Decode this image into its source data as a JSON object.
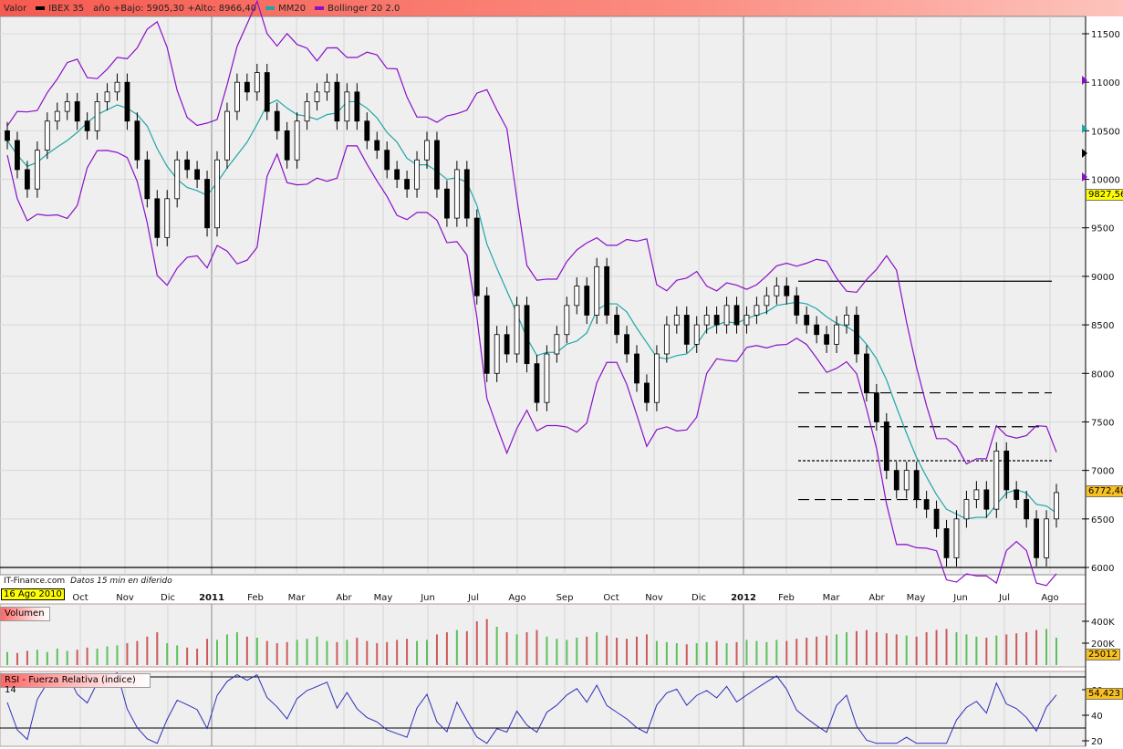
{
  "header": {
    "valor": "Valor",
    "series": "IBEX 35",
    "range": "año +Bajo: 5905,30 +Alto: 8966,40",
    "mm": "MM20",
    "boll": "Bollinger 20 2.0"
  },
  "colors": {
    "mm": "#1fa6a6",
    "boll": "#8a10c8",
    "rsi": "#2e2eb8",
    "vol_up": "#5cc05c",
    "vol_down": "#cc5a5a",
    "header": "#f65a50"
  },
  "credit": {
    "site": "IT-Finance.com",
    "note": "Datos 15 min en diferido"
  },
  "start_date": "16 Ago 2010",
  "volume_title": "Volumen",
  "rsi_title": "RSI - Fuerza Relativa (indice) 14",
  "tags": {
    "price_high": "9827,56",
    "last": "6772,40",
    "volume": "25012",
    "rsi": "54,423"
  },
  "chart_data": {
    "type": "candlestick",
    "title": "IBEX 35",
    "price_axis": {
      "ticks": [
        6000,
        6500,
        7000,
        7500,
        8000,
        8500,
        9000,
        9500,
        10000,
        10500,
        11000,
        11500
      ],
      "ylim": [
        6000,
        11500
      ]
    },
    "months": [
      {
        "l": "Oct",
        "b": false
      },
      {
        "l": "Nov",
        "b": false
      },
      {
        "l": "Dic",
        "b": false
      },
      {
        "l": "2011",
        "b": true
      },
      {
        "l": "Feb",
        "b": false
      },
      {
        "l": "Mar",
        "b": false
      },
      {
        "l": "Abr",
        "b": false
      },
      {
        "l": "May",
        "b": false
      },
      {
        "l": "Jun",
        "b": false
      },
      {
        "l": "Jul",
        "b": false
      },
      {
        "l": "Ago",
        "b": false
      },
      {
        "l": "Sep",
        "b": false
      },
      {
        "l": "Oct",
        "b": false
      },
      {
        "l": "Nov",
        "b": false
      },
      {
        "l": "Dic",
        "b": false
      },
      {
        "l": "2012",
        "b": true
      },
      {
        "l": "Feb",
        "b": false
      },
      {
        "l": "Mar",
        "b": false
      },
      {
        "l": "Abr",
        "b": false
      },
      {
        "l": "May",
        "b": false
      },
      {
        "l": "Jun",
        "b": false
      },
      {
        "l": "Jul",
        "b": false
      },
      {
        "l": "Ago",
        "b": false
      }
    ],
    "closes": [
      10400,
      10100,
      9900,
      10300,
      10600,
      10700,
      10800,
      10600,
      10500,
      10800,
      10900,
      11000,
      10600,
      10200,
      9800,
      9400,
      9800,
      10200,
      10100,
      10000,
      9500,
      10200,
      10700,
      11000,
      10900,
      11100,
      10700,
      10500,
      10200,
      10600,
      10800,
      10900,
      11000,
      10600,
      10900,
      10600,
      10400,
      10300,
      10100,
      10000,
      9900,
      10200,
      10400,
      9900,
      9600,
      10100,
      9600,
      8800,
      8000,
      8400,
      8200,
      8700,
      8100,
      7700,
      8200,
      8400,
      8700,
      8900,
      8600,
      9100,
      8600,
      8400,
      8200,
      7900,
      7700,
      8200,
      8500,
      8600,
      8300,
      8500,
      8600,
      8500,
      8700,
      8500,
      8600,
      8700,
      8800,
      8900,
      8800,
      8600,
      8500,
      8400,
      8300,
      8500,
      8600,
      8200,
      7800,
      7500,
      7000,
      6800,
      7000,
      6700,
      6600,
      6400,
      6100,
      6500,
      6700,
      6800,
      6600,
      7200,
      6800,
      6700,
      6500,
      6100,
      6500,
      6772
    ],
    "volumes": [
      120,
      110,
      130,
      140,
      120,
      150,
      130,
      140,
      160,
      150,
      170,
      180,
      200,
      220,
      260,
      300,
      200,
      180,
      160,
      150,
      240,
      230,
      280,
      300,
      260,
      250,
      220,
      200,
      210,
      230,
      240,
      260,
      220,
      210,
      230,
      250,
      220,
      200,
      210,
      230,
      240,
      220,
      230,
      280,
      300,
      320,
      310,
      400,
      420,
      350,
      300,
      280,
      300,
      320,
      260,
      240,
      230,
      250,
      260,
      300,
      270,
      250,
      240,
      260,
      280,
      220,
      210,
      200,
      190,
      200,
      210,
      220,
      200,
      210,
      230,
      220,
      210,
      230,
      220,
      240,
      250,
      260,
      270,
      280,
      300,
      310,
      320,
      300,
      290,
      280,
      270,
      260,
      300,
      320,
      330,
      300,
      280,
      260,
      250,
      270,
      280,
      290,
      300,
      320,
      330,
      250
    ],
    "volume_axis": {
      "ticks": [
        "400K",
        "200K"
      ]
    },
    "rsi_axis": {
      "ticks": [
        20,
        40,
        60
      ],
      "levels": [
        30,
        70
      ]
    },
    "hlines": [
      {
        "v": 8950,
        "style": "solid"
      },
      {
        "v": 7800,
        "style": "dashed"
      },
      {
        "v": 7450,
        "style": "dashed"
      },
      {
        "v": 7100,
        "style": "dotted"
      },
      {
        "v": 6700,
        "style": "dashed"
      },
      {
        "v": 6000,
        "style": "solid"
      }
    ]
  }
}
